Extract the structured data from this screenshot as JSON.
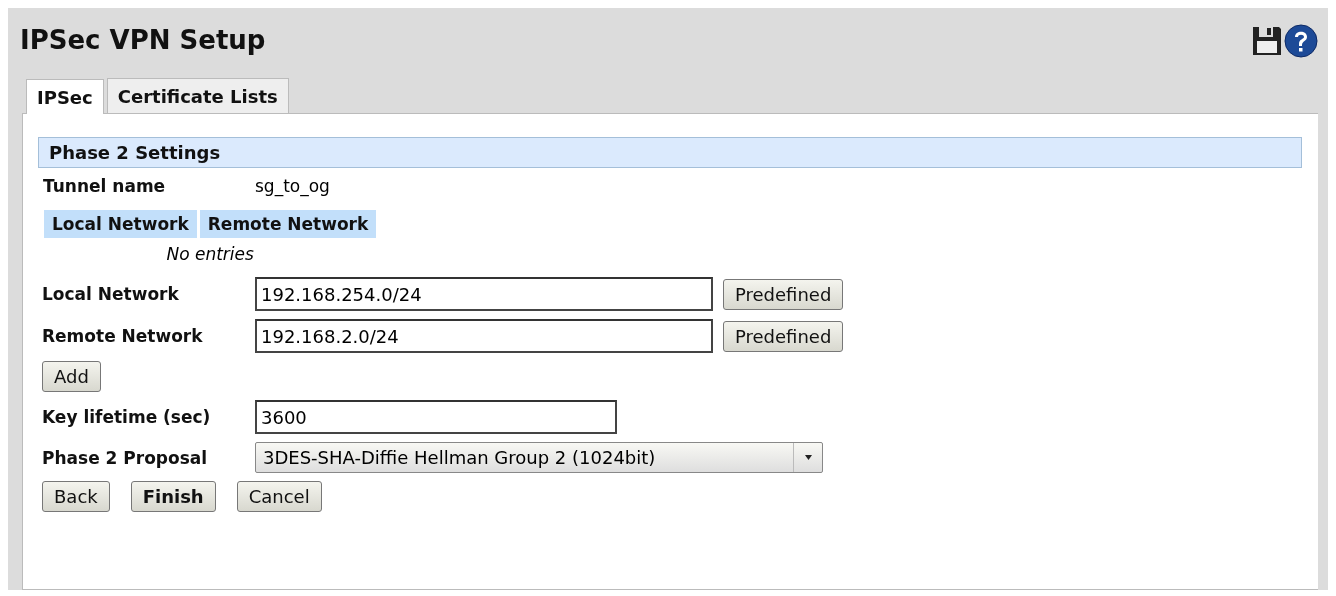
{
  "title": "IPSec VPN Setup",
  "tabs": [
    {
      "label": "IPSec",
      "selected": true
    },
    {
      "label": "Certificate Lists",
      "selected": false
    }
  ],
  "section_title": "Phase 2 Settings",
  "tunnel": {
    "label": "Tunnel name",
    "value": "sg_to_og"
  },
  "networks_table": {
    "columns": [
      "Local Network",
      "Remote Network"
    ],
    "empty_text": "No entries"
  },
  "network_fields": [
    {
      "label": "Local Network",
      "value": "192.168.254.0/24",
      "button": "Predefined"
    },
    {
      "label": "Remote Network",
      "value": "192.168.2.0/24",
      "button": "Predefined"
    }
  ],
  "add_button": "Add",
  "key_lifetime": {
    "label": "Key lifetime (sec)",
    "value": "3600"
  },
  "proposal": {
    "label": "Phase 2 Proposal",
    "value": "3DES-SHA-Diffie Hellman Group 2 (1024bit)"
  },
  "buttons": [
    {
      "label": "Back",
      "primary": false
    },
    {
      "label": "Finish",
      "primary": true
    },
    {
      "label": "Cancel",
      "primary": false
    }
  ]
}
